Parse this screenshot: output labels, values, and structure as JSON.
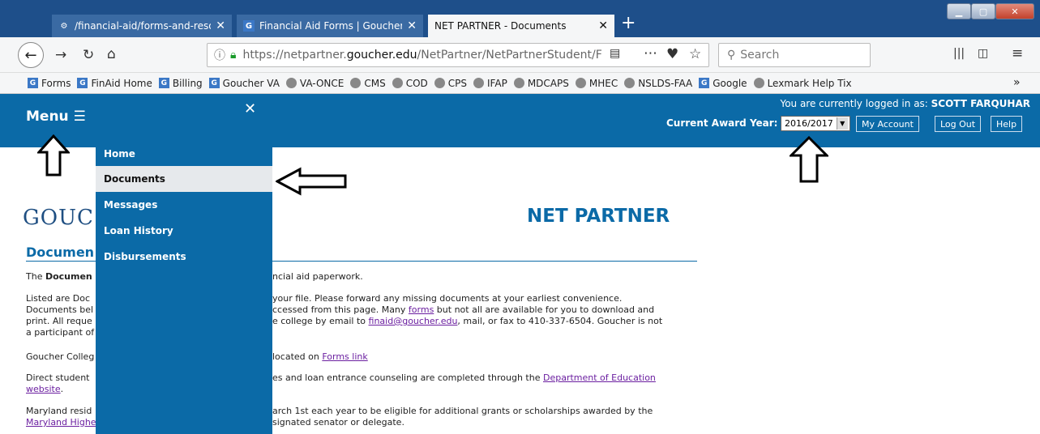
{
  "browser": {
    "tabs": [
      {
        "title": "/financial-aid/forms-and-resou"
      },
      {
        "title": "Financial Aid Forms | Goucher C"
      },
      {
        "title": "NET PARTNER - Documents"
      }
    ],
    "url_prefix": "https://netpartner.",
    "url_host": "goucher.edu",
    "url_path": "/NetPartner/NetPartnerStudent/F",
    "search_placeholder": "Search",
    "bookmarks": [
      {
        "label": "Forms",
        "icon": "G"
      },
      {
        "label": "FinAid Home",
        "icon": "G"
      },
      {
        "label": "Billing",
        "icon": "G"
      },
      {
        "label": "Goucher VA",
        "icon": "G"
      },
      {
        "label": "VA-ONCE",
        "icon": "globe"
      },
      {
        "label": "CMS",
        "icon": "globe"
      },
      {
        "label": "COD",
        "icon": "globe"
      },
      {
        "label": "CPS",
        "icon": "globe"
      },
      {
        "label": "IFAP",
        "icon": "globe"
      },
      {
        "label": "MDCAPS",
        "icon": "globe"
      },
      {
        "label": "MHEC",
        "icon": "globe"
      },
      {
        "label": "NSLDS-FAA",
        "icon": "globe"
      },
      {
        "label": "Google",
        "icon": "G"
      },
      {
        "label": "Lexmark Help Tix",
        "icon": "globe"
      }
    ]
  },
  "header": {
    "menu_label": "Menu ☰",
    "login_prefix": "You are currently logged in as: ",
    "login_user": "SCOTT FARQUHAR",
    "award_year_label": "Current Award Year:",
    "award_year_value": "2016/2017",
    "my_account": "My Account",
    "log_out": "Log Out",
    "help": "Help"
  },
  "menu": {
    "items": [
      {
        "label": "Home"
      },
      {
        "label": "Documents"
      },
      {
        "label": "Messages"
      },
      {
        "label": "Loan History"
      },
      {
        "label": "Disbursements"
      }
    ]
  },
  "page": {
    "logo": "GOUC",
    "site_title": "NET PARTNER",
    "heading": "Documen",
    "p1_left_a": "The ",
    "p1_left_b": "Documen",
    "p1_right": "ncial aid paperwork.",
    "p2_l1": "Listed are Doc",
    "p2_r1": " your file. Please forward any missing documents at your earliest convenience.",
    "p2_l2": "Documents bel",
    "p2_r2a": "ccessed from this page.  Many ",
    "p2_r2_link": "forms",
    "p2_r2b": " but not all are available for you to download and",
    "p2_l3": "print. All reque",
    "p2_r3a": "e college by email to ",
    "p2_r3_link": "finaid@goucher.edu",
    "p2_r3b": ", mail, or fax to 410-337-6504. Goucher is not",
    "p2_l4": "a participant of",
    "p3_left": "Goucher Colleg",
    "p3_right_a": " located on ",
    "p3_right_link": "Forms link",
    "p4_left": "Direct student",
    "p4_right_a": "es and loan entrance counseling are completed through the ",
    "p4_right_link": "Department of Education",
    "p4_l2_link": "website",
    "p4_l2_end": ".",
    "p5_left": "Maryland resid",
    "p5_right": "arch 1st each year to be eligible for additional grants or scholarships awarded by the",
    "p5_l2_link": "Maryland Highe",
    "p5_r2": "signated senator or delegate."
  }
}
